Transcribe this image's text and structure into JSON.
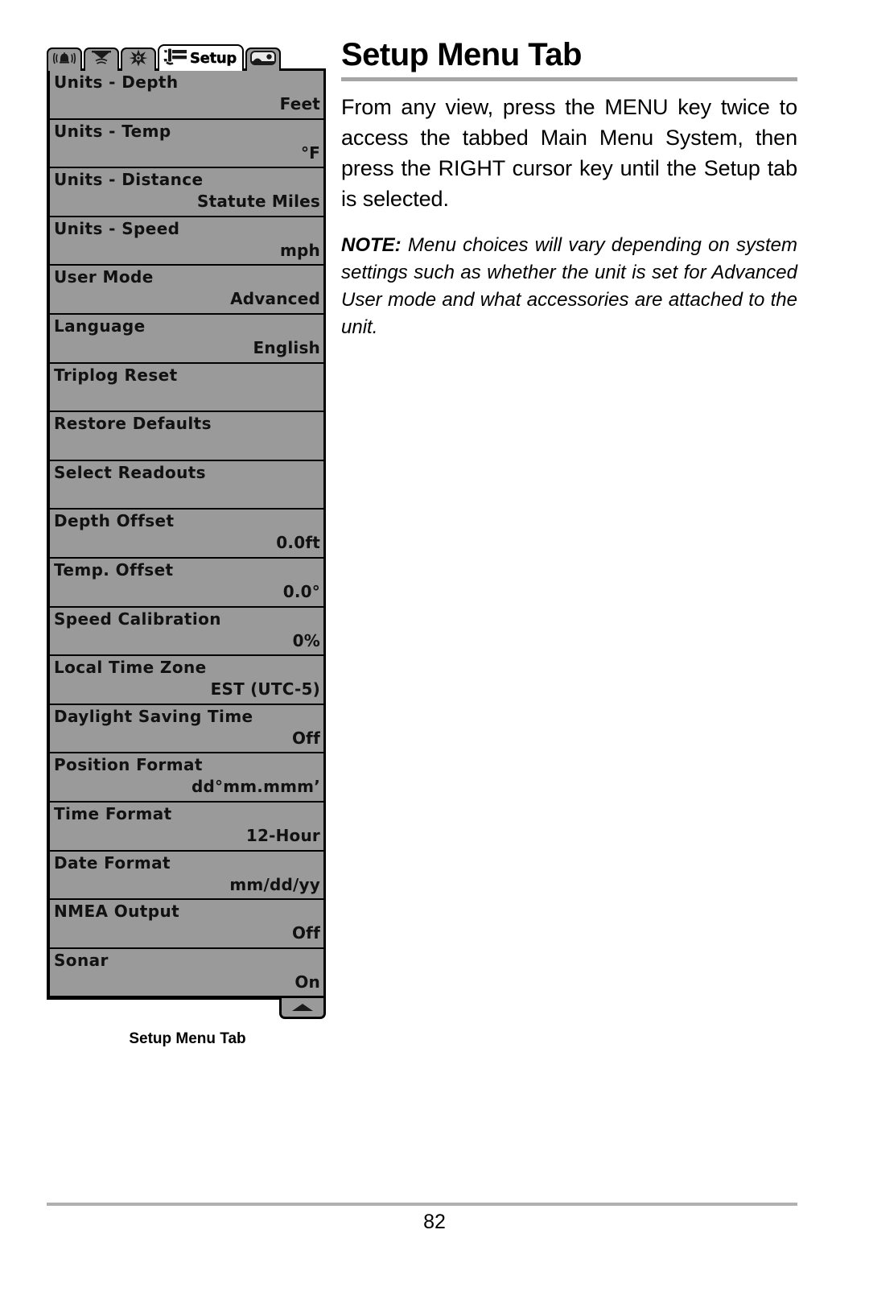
{
  "page": {
    "title": "Setup Menu Tab",
    "number": "82"
  },
  "content": {
    "intro": "From any view, press the MENU key twice to access the tabbed Main Menu System, then press the RIGHT cursor key until the Setup tab is selected.",
    "note_label": "NOTE:",
    "note_text": "Menu choices will vary depending on system settings such as whether the unit is set for Advanced User mode and what accessories are attached to the unit."
  },
  "figure": {
    "caption": "Setup Menu Tab",
    "tabs": [
      {
        "icon": "alarm-bell-icon",
        "label": "",
        "selected": false
      },
      {
        "icon": "sonar-cone-icon",
        "label": "",
        "selected": false
      },
      {
        "icon": "brightness-star-icon",
        "label": "",
        "selected": false
      },
      {
        "icon": "setup-wrench-icon",
        "label": "Setup",
        "selected": true
      },
      {
        "icon": "views-screen-icon",
        "label": "",
        "selected": false
      }
    ],
    "scroll_up_icon": "scroll-up-arrow-icon",
    "menu_items": [
      {
        "label": "Units - Depth",
        "value": "Feet"
      },
      {
        "label": "Units - Temp",
        "value": "°F"
      },
      {
        "label": "Units - Distance",
        "value": "Statute Miles"
      },
      {
        "label": "Units - Speed",
        "value": "mph"
      },
      {
        "label": "User Mode",
        "value": "Advanced"
      },
      {
        "label": "Language",
        "value": "English"
      },
      {
        "label": "Triplog Reset",
        "value": ""
      },
      {
        "label": "Restore Defaults",
        "value": ""
      },
      {
        "label": "Select Readouts",
        "value": ""
      },
      {
        "label": "Depth Offset",
        "value": "0.0ft"
      },
      {
        "label": "Temp. Offset",
        "value": "0.0°"
      },
      {
        "label": "Speed Calibration",
        "value": "0%"
      },
      {
        "label": "Local Time Zone",
        "value": "EST (UTC-5)"
      },
      {
        "label": "Daylight Saving Time",
        "value": "Off"
      },
      {
        "label": "Position Format",
        "value": "dd°mm.mmm’"
      },
      {
        "label": "Time Format",
        "value": "12-Hour"
      },
      {
        "label": "Date Format",
        "value": "mm/dd/yy"
      },
      {
        "label": "NMEA Output",
        "value": "Off"
      },
      {
        "label": "Sonar",
        "value": "On"
      }
    ]
  },
  "colors": {
    "panel_background": "#9a9a9a",
    "panel_border": "#000000",
    "selected_tab_background": "#ffffff",
    "rule": "#a6a6a6"
  }
}
